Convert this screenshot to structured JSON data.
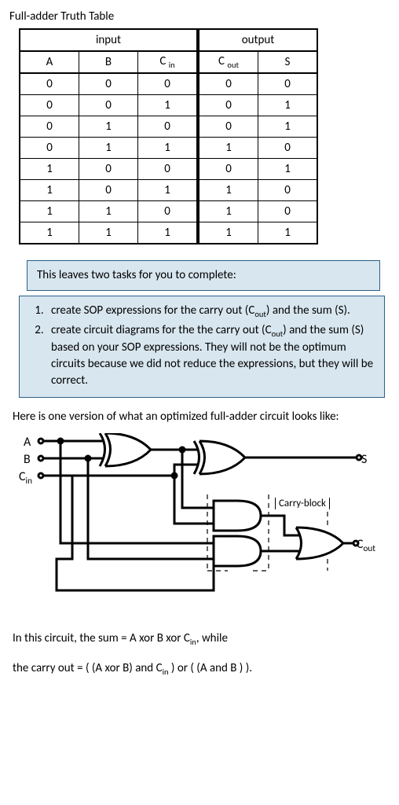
{
  "title": "Full-adder Truth Table",
  "table": {
    "group_input": "input",
    "group_output": "output",
    "headers": {
      "A": "A",
      "B": "B",
      "Cin_base": "C",
      "Cin_sub": "in",
      "Cout_base": "C",
      "Cout_sub": "out",
      "S": "S"
    },
    "rows": [
      {
        "A": "0",
        "B": "0",
        "Cin": "0",
        "Cout": "0",
        "S": "0"
      },
      {
        "A": "0",
        "B": "0",
        "Cin": "1",
        "Cout": "0",
        "S": "1"
      },
      {
        "A": "0",
        "B": "1",
        "Cin": "0",
        "Cout": "0",
        "S": "1"
      },
      {
        "A": "0",
        "B": "1",
        "Cin": "1",
        "Cout": "1",
        "S": "0"
      },
      {
        "A": "1",
        "B": "0",
        "Cin": "0",
        "Cout": "0",
        "S": "1"
      },
      {
        "A": "1",
        "B": "0",
        "Cin": "1",
        "Cout": "1",
        "S": "0"
      },
      {
        "A": "1",
        "B": "1",
        "Cin": "0",
        "Cout": "1",
        "S": "0"
      },
      {
        "A": "1",
        "B": "1",
        "Cin": "1",
        "Cout": "1",
        "S": "1"
      }
    ]
  },
  "callout_intro": "This leaves two tasks for you to complete:",
  "tasks": {
    "t1_a": "create SOP expressions for  the carry out (C",
    "t1_sub": "out",
    "t1_b": ") and the sum (S).",
    "t2_a": "create circuit diagrams for the the carry out (C",
    "t2_sub": "out",
    "t2_b": ") and the sum (S) based on your SOP expressions. They will not be the optimum circuits because we did not reduce the expressions, but they will be correct."
  },
  "intro2": "Here is one version of what an optimized full-adder circuit looks like:",
  "circuit": {
    "A": "A",
    "B": "B",
    "Cin_base": "C",
    "Cin_sub": "in",
    "S": "S",
    "Cout_base": "C",
    "Cout_sub": "out",
    "carry_block": "Carry-block"
  },
  "eq1_a": "In this circuit, the sum = A xor B xor C",
  "eq1_sub": "in",
  "eq1_b": ", while",
  "eq2_a": "the carry out = ( (A xor B) and C",
  "eq2_sub": "in",
  "eq2_b": " ) or ( (A and B ) )."
}
